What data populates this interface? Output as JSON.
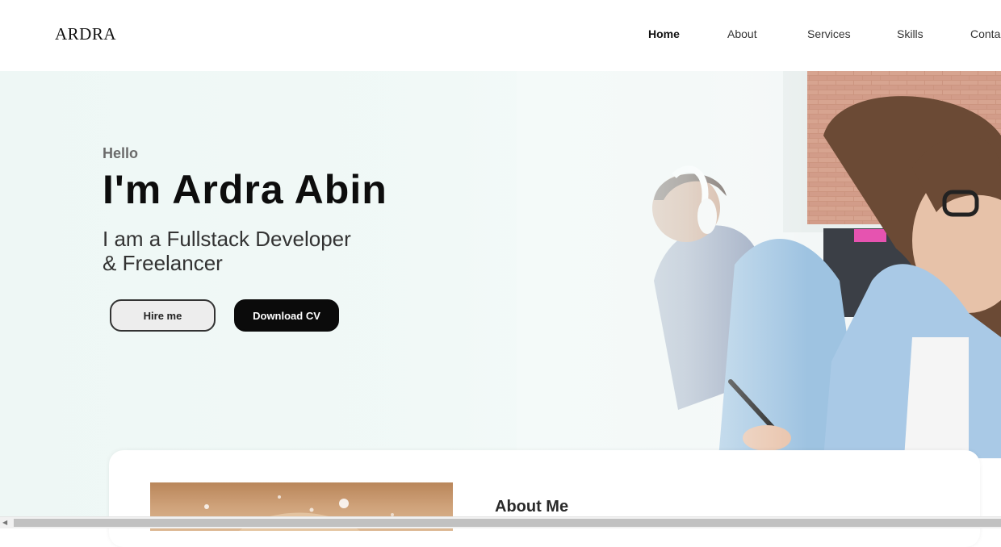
{
  "header": {
    "logo": "ARDRA",
    "nav": [
      {
        "label": "Home",
        "active": true
      },
      {
        "label": "About",
        "active": false
      },
      {
        "label": "Services",
        "active": false
      },
      {
        "label": "Skills",
        "active": false
      },
      {
        "label": "Conta",
        "active": false
      }
    ]
  },
  "hero": {
    "greeting": "Hello",
    "headline": "I'm Ardra Abin",
    "subline_1": "I am a Fullstack Developer",
    "subline_2": "& Freelancer",
    "hire_button": "Hire me",
    "cv_button": "Download CV"
  },
  "about": {
    "title": "About Me"
  }
}
